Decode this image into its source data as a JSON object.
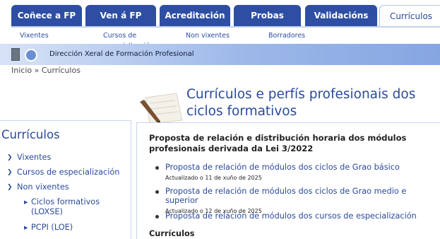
{
  "tabs": [
    {
      "label": "Coñece a FP"
    },
    {
      "label": "Ven á FP"
    },
    {
      "label": "Acreditación"
    },
    {
      "label": "Probas"
    },
    {
      "label": "Validacións"
    },
    {
      "label": "Currículos"
    }
  ],
  "subnav": [
    {
      "label": "Vixentes"
    },
    {
      "label": "Cursos de especialización"
    },
    {
      "label": "Non vixentes"
    },
    {
      "label": "Borradores"
    }
  ],
  "banner": {
    "org": "Dirección Xeral de Formación Profesional"
  },
  "breadcrumb": "Inicio » Currículos",
  "page_title": "Currículos e perfís profesionais dos ciclos formativos",
  "sidebar": {
    "title": "Currículos",
    "items": [
      {
        "label": "Vixentes"
      },
      {
        "label": "Cursos de especialización"
      },
      {
        "label": "Non vixentes"
      }
    ],
    "subitems": [
      {
        "label": "Ciclos formativos (LOXSE)"
      },
      {
        "label": "PCPI (LOE)"
      }
    ]
  },
  "content": {
    "intro": "Proposta de relación e distribución horaria dos módulos profesionais derivada da Lei 3/2022",
    "docs": [
      {
        "link": "Proposta de relación de módulos dos ciclos de Grao básico",
        "date": "Actualizado o 11 de xuño de 2025"
      },
      {
        "link": "Proposta de relación de módulos dos ciclos de Grao medio e superior",
        "date": "Actualizado o 12 de xuño de 2025"
      },
      {
        "link": "Proposta de relación de módulos dos cursos de especialización",
        "date": ""
      }
    ],
    "section_heading": "Currículos"
  },
  "colors": {
    "tab": "#2d4ea3",
    "link": "#2a4a9a",
    "banner": "#9db8e9"
  },
  "icons": {
    "sidebar_chevron": "chevron-double-icon",
    "sub_triangle": "triangle-right-icon",
    "bullet": "bullet-icon"
  }
}
